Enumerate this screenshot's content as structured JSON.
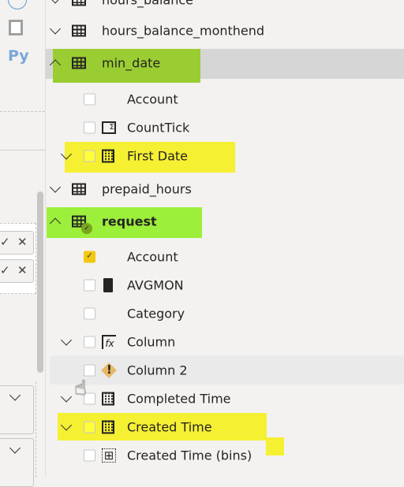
{
  "left_panel": {
    "python_label": "Py",
    "filter_check": "✓",
    "filter_clear": "✕"
  },
  "fields": {
    "tables": [
      {
        "name": "hours_balance"
      },
      {
        "name": "hours_balance_monthend"
      },
      {
        "name": "min_date",
        "expanded": true,
        "highlight": "#9acd32"
      },
      {
        "name": "prepaid_hours"
      },
      {
        "name": "request",
        "expanded": true,
        "highlight": "#9cef3a"
      }
    ],
    "min_date_fields": [
      {
        "name": "Account",
        "checked": false
      },
      {
        "name": "CountTick",
        "checked": false
      },
      {
        "name": "First Date",
        "checked": false,
        "highlight": "#f5f032"
      }
    ],
    "request_fields": [
      {
        "name": "Account",
        "checked": true
      },
      {
        "name": "AVGMON",
        "checked": false
      },
      {
        "name": "Category",
        "checked": false
      },
      {
        "name": "Column",
        "checked": false
      },
      {
        "name": "Column 2",
        "checked": false
      },
      {
        "name": "Completed Time",
        "checked": false
      },
      {
        "name": "Created Time",
        "checked": false,
        "highlight": "#f5f032"
      },
      {
        "name": "Created Time (bins)",
        "checked": false
      }
    ]
  },
  "colors": {
    "check_accent": "#f2c811",
    "warning": "#e8b765"
  }
}
